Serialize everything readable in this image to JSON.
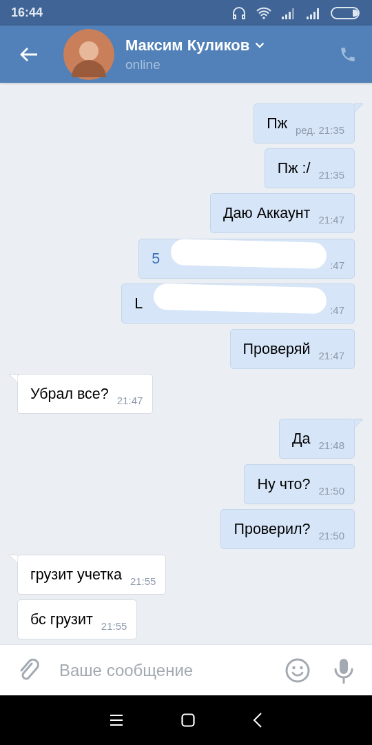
{
  "status_bar": {
    "time": "16:44"
  },
  "header": {
    "name": "Максим Куликов",
    "status": "online"
  },
  "messages": [
    {
      "kind": "outgoing",
      "text": "Пж",
      "time": "ред. 21:35",
      "tail": true,
      "redacted": false,
      "link": false
    },
    {
      "kind": "outgoing",
      "text": "Пж :/",
      "time": "21:35",
      "tail": false,
      "redacted": false,
      "link": false
    },
    {
      "kind": "outgoing",
      "text": "Даю Аккаунт",
      "time": "21:47",
      "tail": false,
      "redacted": false,
      "link": false
    },
    {
      "kind": "outgoing",
      "text": "5",
      "time": ":47",
      "tail": false,
      "redacted": true,
      "link": true
    },
    {
      "kind": "outgoing",
      "text": "L",
      "time": ":47",
      "tail": false,
      "redacted": true,
      "link": false
    },
    {
      "kind": "outgoing",
      "text": "Проверяй",
      "time": "21:47",
      "tail": false,
      "redacted": false,
      "link": false
    },
    {
      "kind": "incoming",
      "text": "Убрал все?",
      "time": "21:47",
      "tail": true,
      "redacted": false,
      "link": false
    },
    {
      "kind": "outgoing",
      "text": "Да",
      "time": "21:48",
      "tail": true,
      "redacted": false,
      "link": false
    },
    {
      "kind": "outgoing",
      "text": "Ну что?",
      "time": "21:50",
      "tail": false,
      "redacted": false,
      "link": false
    },
    {
      "kind": "outgoing",
      "text": "Проверил?",
      "time": "21:50",
      "tail": false,
      "redacted": false,
      "link": false
    },
    {
      "kind": "incoming",
      "text": "грузит учетка",
      "time": "21:55",
      "tail": true,
      "redacted": false,
      "link": false
    },
    {
      "kind": "incoming",
      "text": "бс грузит",
      "time": "21:55",
      "tail": false,
      "redacted": false,
      "link": false
    }
  ],
  "composer": {
    "placeholder": "Ваше сообщение"
  }
}
